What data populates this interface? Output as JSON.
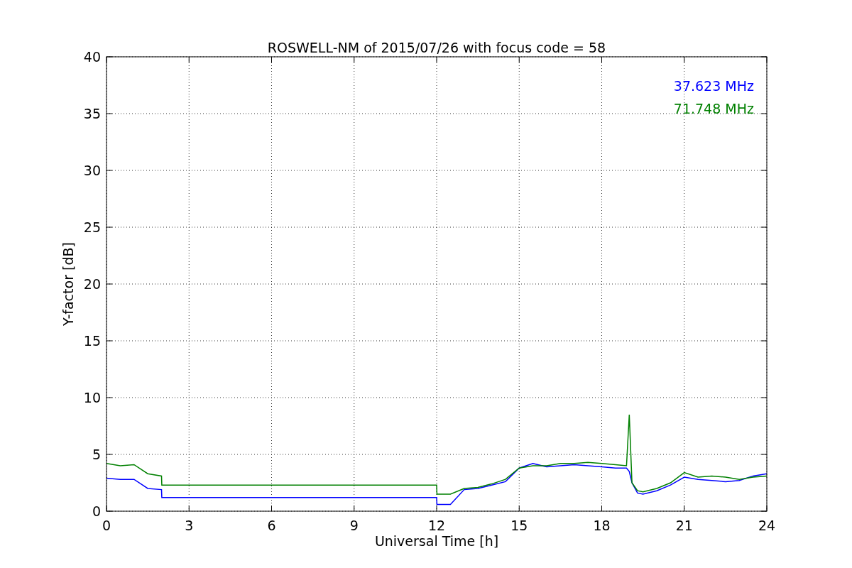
{
  "figure": {
    "chart_data": {
      "type": "line",
      "title": "ROSWELL-NM of 2015/07/26 with focus code = 58",
      "xlabel": "Universal Time [h]",
      "ylabel": "Y-factor [dB]",
      "x": [
        0,
        0.5,
        1,
        1.5,
        2,
        2.01,
        6,
        12,
        12.01,
        12.5,
        13,
        13.5,
        14,
        14.5,
        15,
        15.5,
        16,
        16.5,
        17,
        17.5,
        18,
        18.5,
        18.9,
        19,
        19.1,
        19.3,
        19.5,
        20,
        20.5,
        21,
        21.5,
        22,
        22.5,
        23,
        23.5,
        24
      ],
      "series": [
        {
          "name": "37.623 MHz",
          "color": "#0000ff",
          "values": [
            2.9,
            2.8,
            2.8,
            2.0,
            1.9,
            1.2,
            1.2,
            1.2,
            0.6,
            0.6,
            1.9,
            2.0,
            2.3,
            2.6,
            3.8,
            4.2,
            3.9,
            4.0,
            4.1,
            4.0,
            3.9,
            3.8,
            3.8,
            3.5,
            2.5,
            1.6,
            1.5,
            1.8,
            2.3,
            3.0,
            2.8,
            2.7,
            2.6,
            2.7,
            3.1,
            3.3
          ]
        },
        {
          "name": "71.748 MHz",
          "color": "#008000",
          "values": [
            4.2,
            4.0,
            4.1,
            3.3,
            3.1,
            2.3,
            2.3,
            2.3,
            1.5,
            1.5,
            2.0,
            2.1,
            2.4,
            2.8,
            3.8,
            4.0,
            4.0,
            4.2,
            4.2,
            4.3,
            4.2,
            4.1,
            4.0,
            8.5,
            2.5,
            1.8,
            1.7,
            2.0,
            2.5,
            3.4,
            3.0,
            3.1,
            3.0,
            2.8,
            3.0,
            3.1
          ]
        }
      ],
      "xlim": [
        0,
        24
      ],
      "ylim": [
        0,
        40
      ],
      "xticks": [
        0,
        3,
        6,
        9,
        12,
        15,
        18,
        21,
        24
      ],
      "yticks": [
        0,
        5,
        10,
        15,
        20,
        25,
        30,
        35,
        40
      ],
      "grid": true
    }
  }
}
